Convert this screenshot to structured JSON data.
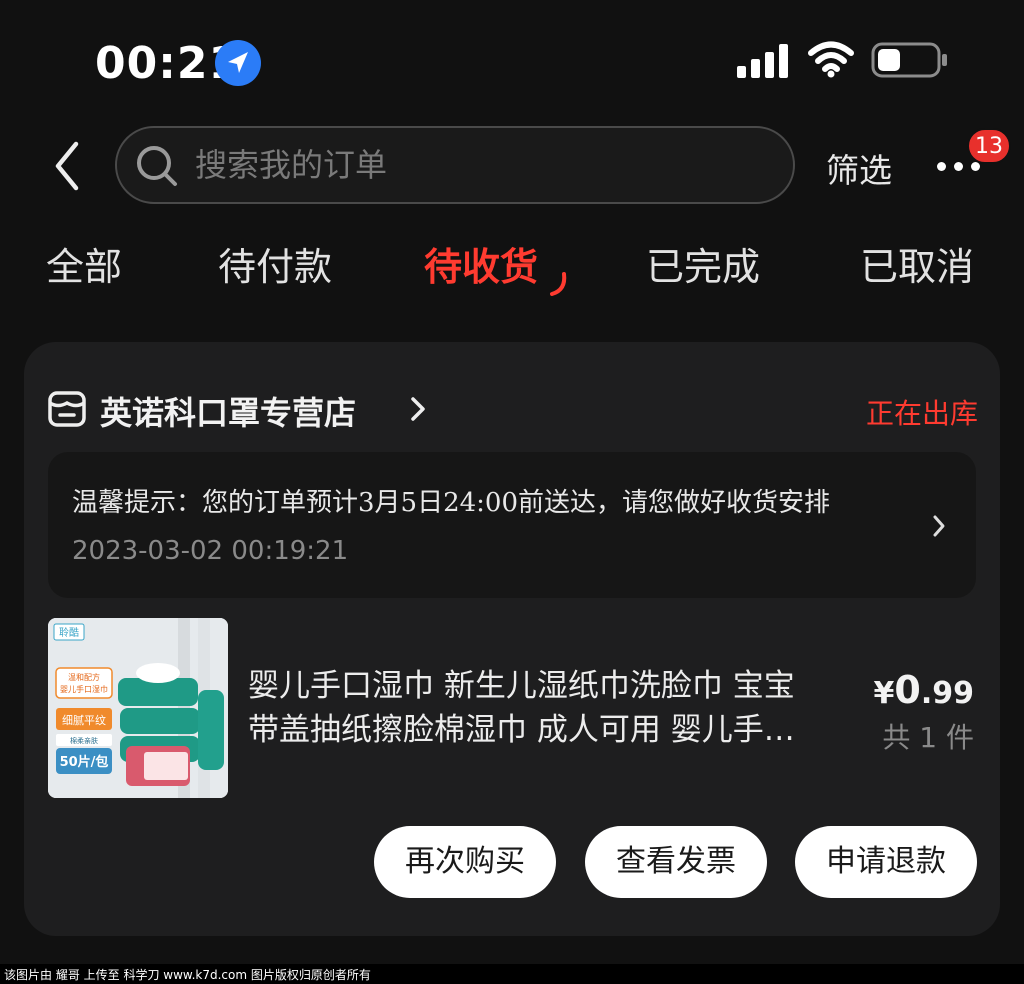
{
  "status_bar": {
    "time": "00:21",
    "icons": [
      "location-icon",
      "signal-icon",
      "wifi-icon",
      "battery-icon"
    ]
  },
  "header": {
    "back_icon": "chevron-left-icon",
    "search_placeholder": "搜索我的订单",
    "filter_label": "筛选",
    "more_badge": "13"
  },
  "tabs": [
    {
      "label": "全部",
      "active": false
    },
    {
      "label": "待付款",
      "active": false
    },
    {
      "label": "待收货",
      "active": true
    },
    {
      "label": "已完成",
      "active": false
    },
    {
      "label": "已取消",
      "active": false
    }
  ],
  "order": {
    "store_name": "英诺科口罩专营店",
    "status": "正在出库",
    "tip": {
      "text": "温馨提示：您的订单预计3月5日24:00前送达，请您做好收货安排",
      "timestamp": "2023-03-02 00:19:21"
    },
    "product": {
      "title_line1": "婴儿手口湿巾 新生儿湿纸巾洗脸巾 宝宝",
      "title_line2": "带盖抽纸擦脸棉湿巾 成人可用 婴儿手…",
      "price_symbol": "¥",
      "price_int": "0",
      "price_dec": ".99",
      "quantity": "共 1 件",
      "image_labels": {
        "brand": "聆酷",
        "line1": "温和配方",
        "line2": "婴儿手口湿巾",
        "feature": "细腻平纹",
        "sub": "棉柔亲肤",
        "count": "50片/包"
      }
    },
    "actions": [
      "再次购买",
      "查看发票",
      "申请退款"
    ]
  },
  "watermark": "该图片由 耀哥 上传至 科学刀 www.k7d.com 图片版权归原创者所有",
  "colors": {
    "accent": "#ff3b30",
    "background": "#111111",
    "card": "#1e1e1f"
  }
}
